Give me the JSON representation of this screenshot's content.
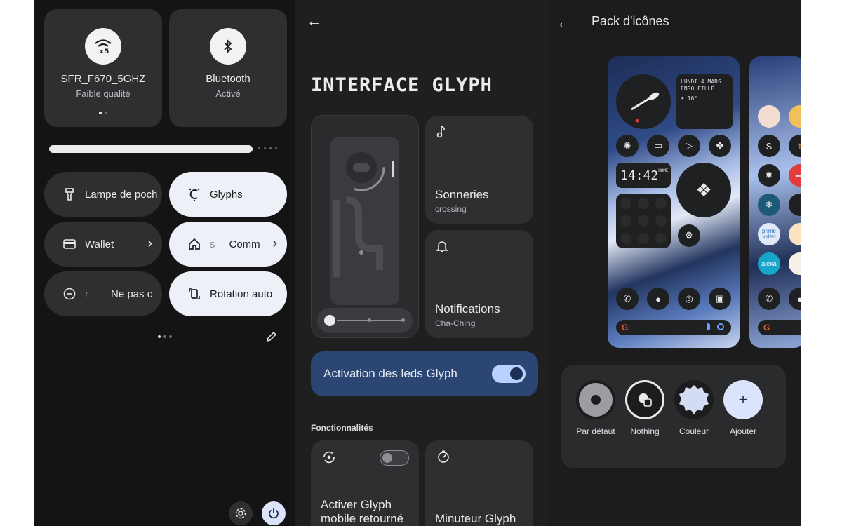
{
  "quick_settings": {
    "wifi_tile": {
      "name": "SFR_F670_5GHZ",
      "status": "Faible qualité",
      "icon": "wifi-x-icon"
    },
    "bluetooth_tile": {
      "name": "Bluetooth",
      "status": "Activé",
      "icon": "bluetooth-icon"
    },
    "brightness_level": 0.82,
    "tiles": {
      "flashlight": "Lampe de poch",
      "glyphs": "Glyphs",
      "wallet": "Wallet",
      "home_prefix": "s",
      "home": "Comm",
      "dnd_prefix": "r",
      "dnd": "Ne pas c",
      "rotation": "Rotation auto"
    }
  },
  "glyph": {
    "title": "INTERFACE GLYPH",
    "ringtones": {
      "title": "Sonneries",
      "subtitle": "crossing"
    },
    "notifications": {
      "title": "Notifications",
      "subtitle": "Cha-Ching"
    },
    "activation_label": "Activation des leds Glyph",
    "activation_on": true,
    "section_label": "Fonctionnalités",
    "flip_label": "Activer Glyph mobile retourné",
    "flip_on": false,
    "timer_label": "Minuteur Glyph"
  },
  "icon_pack": {
    "title": "Pack d'icônes",
    "widgets": {
      "date": "LUNDI 4 MARS ENSOLEILLÉ",
      "weather": "☀ 16°",
      "time": "14:42",
      "time_tag": "HOME"
    },
    "options": [
      {
        "label": "Par défaut"
      },
      {
        "label": "Nothing"
      },
      {
        "label": "Couleur"
      },
      {
        "label": "Ajouter"
      }
    ],
    "apps_second": [
      "prime video",
      "alexa"
    ]
  },
  "colors": {
    "accent": "#2b4673",
    "toggle_on": "#b9d0ff",
    "surface": "#2e2f31",
    "light_pill": "#eef0f8"
  }
}
